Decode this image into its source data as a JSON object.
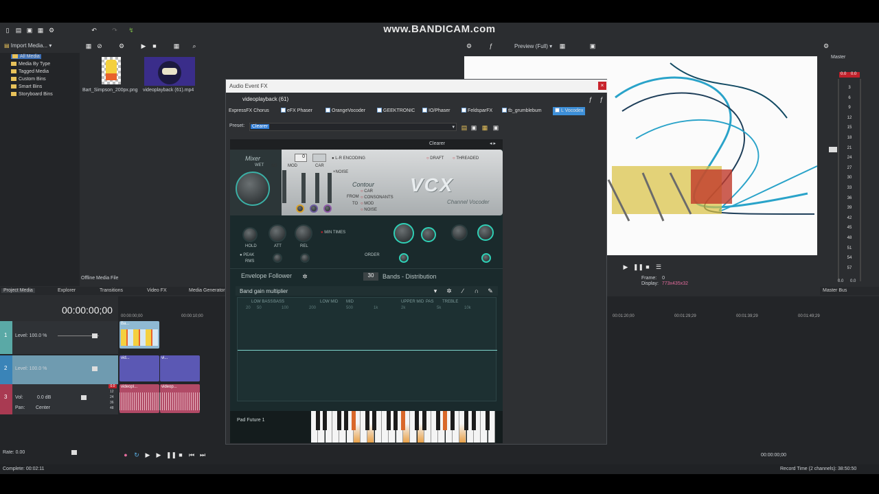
{
  "watermark": "www.BANDICAM.com",
  "toolbar_left": {
    "import_media": "Import Media..."
  },
  "media_tree": [
    "All Media",
    "Media By Type",
    "Tagged Media",
    "Custom Bins",
    "Smart Bins",
    "Storyboard Bins"
  ],
  "media_files": [
    {
      "name": "Bart_Simpson_200px.png"
    },
    {
      "name": "videoplayback (61).mp4"
    }
  ],
  "offline_label": "Offline Media File",
  "panel_tabs": [
    "Project Media",
    "Explorer",
    "Transitions",
    "Video FX",
    "Media Generator"
  ],
  "preview": {
    "mode": "Preview (Full)",
    "frame_label": "Frame:",
    "frame_value": "0",
    "display_label": "Display:",
    "display_value": "773x435x32"
  },
  "master": {
    "title": "Master",
    "peak_left": "0.0",
    "peak_right": "0.0",
    "bottom_left": "0.0",
    "bottom_right": "0.0",
    "bus_tab": "Master Bus",
    "scale": [
      "3",
      "6",
      "9",
      "12",
      "15",
      "18",
      "21",
      "24",
      "27",
      "30",
      "33",
      "36",
      "39",
      "42",
      "45",
      "48",
      "51",
      "54",
      "57"
    ]
  },
  "timeline": {
    "timecode": "00:00:00;00",
    "ruler_start": "00:00:00;00",
    "ruler_2": "00:00:10;00",
    "ruler_right": [
      "00:01:20;00",
      "00:01:29;29",
      "00:01:39;29",
      "00:01:49;29"
    ],
    "tracks": [
      {
        "num": "1",
        "level": "Level: 100.0 %",
        "clip": "Ba..."
      },
      {
        "num": "2",
        "level": "Level: 100.0 %",
        "clip_a": "vid...",
        "clip_b": "vi..."
      },
      {
        "num": "3",
        "vol_label": "Vol:",
        "vol_value": "0.0 dB",
        "pan_label": "Pan:",
        "pan_value": "Center",
        "clip_a": "videopl...",
        "clip_b": "videop...",
        "db_scale": [
          "12",
          "24",
          "36",
          "48"
        ],
        "peak": "0.0"
      }
    ],
    "rate": "Rate: 0.00",
    "end_timecode": "00:00:00;00"
  },
  "status": {
    "complete": "Complete: 00:02:11",
    "record": "Record Time (2 channels): 38:50:50"
  },
  "dialog": {
    "title": "Audio Event FX",
    "media_name": "videoplayback (61)",
    "chain": [
      "ExpressFX Chorus",
      "eFX Phaser",
      "OrangeVocoder",
      "GEEKTRONIC",
      "IO/Phaser",
      "FeldsparFX",
      "tb_grumblebum",
      "L Vocodex"
    ],
    "preset_label": "Preset:",
    "preset_value": "Clearer",
    "vst": {
      "preset": "Clearer",
      "mixer": "Mixer",
      "wet": "WET",
      "sg": "SG",
      "mod": "MOD",
      "car": "CAR",
      "noise": "+NOISE",
      "mixer_value": "0",
      "lr_encoding": "L-R ENCODING",
      "draft": "DRAFT",
      "threaded": "THREADED",
      "contour": "Contour",
      "contour_opts": [
        "CAR",
        "CONSONANTS",
        "MOD",
        "NOISE"
      ],
      "from": "FROM",
      "to": "TO",
      "logo": "VCX",
      "subtitle": "Channel Vocoder",
      "hold": "HOLD",
      "att": "ATT",
      "rel": "REL",
      "min_times": "MIN TIMES",
      "peak": "PEAK",
      "rms": "RMS",
      "order": "ORDER",
      "env_follower": "Envelope Follower",
      "bands_value": "30",
      "bands_label": "Bands - Distribution",
      "band_gain": "Band gain multiplier",
      "band_regions": [
        "LOW BASS",
        "BASS",
        "LOW MID",
        "MID",
        "UPPER MID",
        "PAS",
        "TREBLE"
      ],
      "freqs": [
        "20",
        "50",
        "100",
        "200",
        "500",
        "1k",
        "2k",
        "5k",
        "10k"
      ],
      "instrument": "Pad Future 1"
    }
  }
}
